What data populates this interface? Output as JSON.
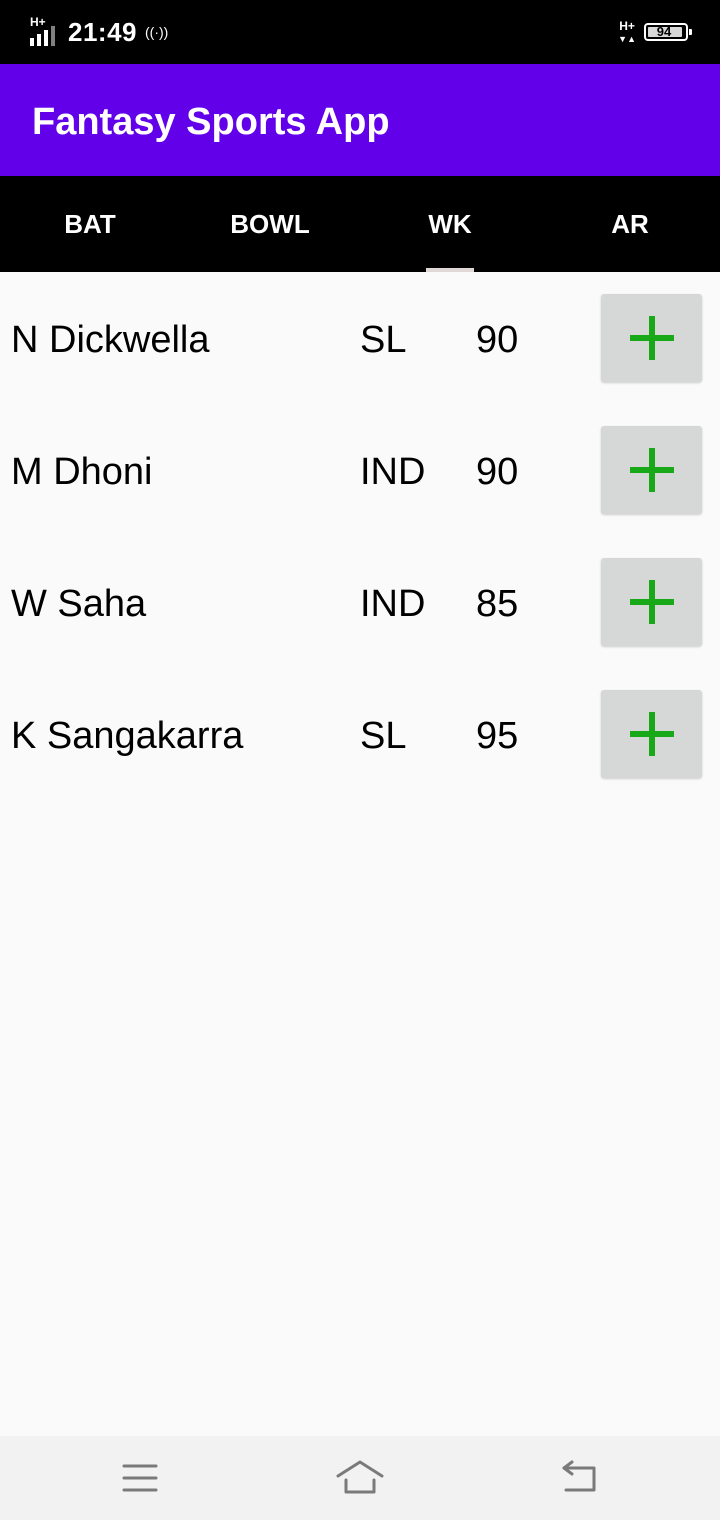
{
  "status_bar": {
    "network": "H+",
    "time": "21:49",
    "hotspot": "((·))",
    "network_right": "H+",
    "battery": "94"
  },
  "app_bar": {
    "title": "Fantasy Sports App",
    "color": "#6200ea"
  },
  "tabs": [
    {
      "label": "BAT",
      "active": false
    },
    {
      "label": "BOWL",
      "active": false
    },
    {
      "label": "WK",
      "active": true
    },
    {
      "label": "AR",
      "active": false
    }
  ],
  "players": [
    {
      "name": "N Dickwella",
      "team": "SL",
      "points": "90"
    },
    {
      "name": "M Dhoni",
      "team": "IND",
      "points": "90"
    },
    {
      "name": "W Saha",
      "team": "IND",
      "points": "85"
    },
    {
      "name": "K Sangakarra",
      "team": "SL",
      "points": "95"
    }
  ],
  "icons": {
    "add": "plus-icon",
    "nav_menu": "menu-icon",
    "nav_home": "home-icon",
    "nav_back": "back-icon"
  },
  "colors": {
    "accent_add": "#18a818",
    "tab_bar": "#000000"
  }
}
